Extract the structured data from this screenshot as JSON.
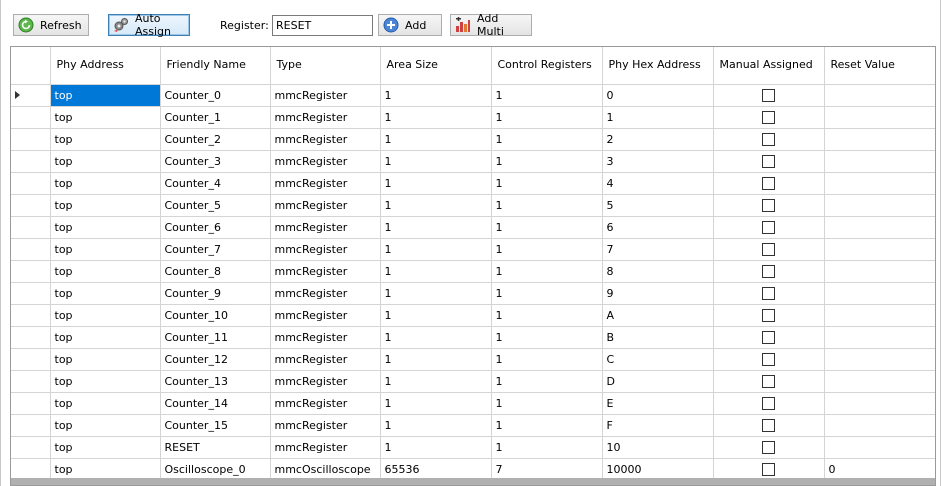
{
  "toolbar": {
    "refresh_label": "Refresh",
    "auto_assign_label": "Auto Assign",
    "register_label": "Register:",
    "register_value": "RESET",
    "add_label": "Add",
    "add_multi_label": "Add Multi"
  },
  "grid": {
    "columns": [
      "Phy Address",
      "Friendly Name",
      "Type",
      "Area Size",
      "Control Registers",
      "Phy Hex Address",
      "Manual Assigned",
      "Reset Value"
    ],
    "rows": [
      {
        "phy": "top",
        "name": "Counter_0",
        "type": "mmcRegister",
        "area": "1",
        "ctrl": "1",
        "hex": "0",
        "manual": false,
        "reset": ""
      },
      {
        "phy": "top",
        "name": "Counter_1",
        "type": "mmcRegister",
        "area": "1",
        "ctrl": "1",
        "hex": "1",
        "manual": false,
        "reset": ""
      },
      {
        "phy": "top",
        "name": "Counter_2",
        "type": "mmcRegister",
        "area": "1",
        "ctrl": "1",
        "hex": "2",
        "manual": false,
        "reset": ""
      },
      {
        "phy": "top",
        "name": "Counter_3",
        "type": "mmcRegister",
        "area": "1",
        "ctrl": "1",
        "hex": "3",
        "manual": false,
        "reset": ""
      },
      {
        "phy": "top",
        "name": "Counter_4",
        "type": "mmcRegister",
        "area": "1",
        "ctrl": "1",
        "hex": "4",
        "manual": false,
        "reset": ""
      },
      {
        "phy": "top",
        "name": "Counter_5",
        "type": "mmcRegister",
        "area": "1",
        "ctrl": "1",
        "hex": "5",
        "manual": false,
        "reset": ""
      },
      {
        "phy": "top",
        "name": "Counter_6",
        "type": "mmcRegister",
        "area": "1",
        "ctrl": "1",
        "hex": "6",
        "manual": false,
        "reset": ""
      },
      {
        "phy": "top",
        "name": "Counter_7",
        "type": "mmcRegister",
        "area": "1",
        "ctrl": "1",
        "hex": "7",
        "manual": false,
        "reset": ""
      },
      {
        "phy": "top",
        "name": "Counter_8",
        "type": "mmcRegister",
        "area": "1",
        "ctrl": "1",
        "hex": "8",
        "manual": false,
        "reset": ""
      },
      {
        "phy": "top",
        "name": "Counter_9",
        "type": "mmcRegister",
        "area": "1",
        "ctrl": "1",
        "hex": "9",
        "manual": false,
        "reset": ""
      },
      {
        "phy": "top",
        "name": "Counter_10",
        "type": "mmcRegister",
        "area": "1",
        "ctrl": "1",
        "hex": "A",
        "manual": false,
        "reset": ""
      },
      {
        "phy": "top",
        "name": "Counter_11",
        "type": "mmcRegister",
        "area": "1",
        "ctrl": "1",
        "hex": "B",
        "manual": false,
        "reset": ""
      },
      {
        "phy": "top",
        "name": "Counter_12",
        "type": "mmcRegister",
        "area": "1",
        "ctrl": "1",
        "hex": "C",
        "manual": false,
        "reset": ""
      },
      {
        "phy": "top",
        "name": "Counter_13",
        "type": "mmcRegister",
        "area": "1",
        "ctrl": "1",
        "hex": "D",
        "manual": false,
        "reset": ""
      },
      {
        "phy": "top",
        "name": "Counter_14",
        "type": "mmcRegister",
        "area": "1",
        "ctrl": "1",
        "hex": "E",
        "manual": false,
        "reset": ""
      },
      {
        "phy": "top",
        "name": "Counter_15",
        "type": "mmcRegister",
        "area": "1",
        "ctrl": "1",
        "hex": "F",
        "manual": false,
        "reset": ""
      },
      {
        "phy": "top",
        "name": "RESET",
        "type": "mmcRegister",
        "area": "1",
        "ctrl": "1",
        "hex": "10",
        "manual": false,
        "reset": ""
      },
      {
        "phy": "top",
        "name": "Oscilloscope_0",
        "type": "mmcOscilloscope",
        "area": "65536",
        "ctrl": "7",
        "hex": "10000",
        "manual": false,
        "reset": "0"
      }
    ],
    "selected_row": 0
  },
  "colors": {
    "selection": "#0078d7",
    "refresh_icon": "#4caf3a",
    "add_icon": "#3b78d8"
  }
}
